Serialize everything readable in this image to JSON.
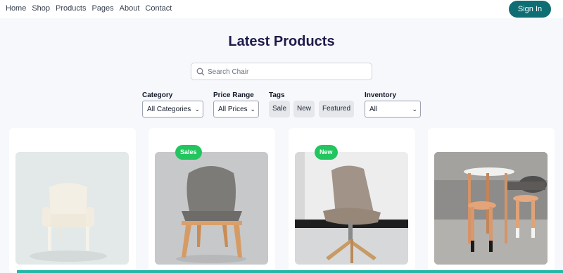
{
  "nav": {
    "links": [
      "Home",
      "Shop",
      "Products",
      "Pages",
      "About",
      "Contact"
    ],
    "signin_label": "Sign In"
  },
  "page": {
    "title": "Latest Products"
  },
  "search": {
    "placeholder": "Search Chair",
    "icon": "search-icon"
  },
  "filters": {
    "category": {
      "label": "Category",
      "selected": "All Categories"
    },
    "price_range": {
      "label": "Price Range",
      "selected": "All Prices"
    },
    "tags": {
      "label": "Tags",
      "items": [
        "Sale",
        "New",
        "Featured"
      ]
    },
    "inventory": {
      "label": "Inventory",
      "selected": "All"
    }
  },
  "products": [
    {
      "badge": ""
    },
    {
      "badge": "Sales"
    },
    {
      "badge": "New"
    },
    {
      "badge": ""
    }
  ],
  "colors": {
    "brand": "#0f6e74",
    "badge": "#22c55e",
    "accent_strip": "#22b7a8"
  }
}
